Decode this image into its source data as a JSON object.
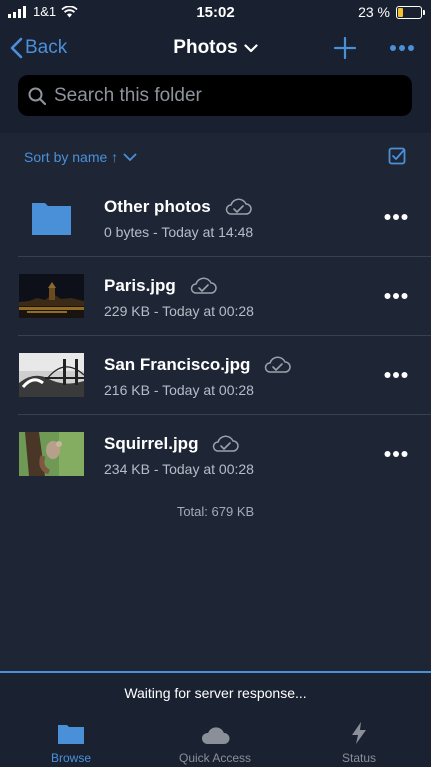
{
  "status_bar": {
    "carrier": "1&1",
    "time": "15:02",
    "battery_percent": "23 %",
    "battery_level": 0.23
  },
  "nav": {
    "back_label": "Back",
    "title": "Photos"
  },
  "search": {
    "placeholder": "Search this folder"
  },
  "sort": {
    "label": "Sort by name ↑"
  },
  "files": [
    {
      "name": "Other photos",
      "meta": "0 bytes - Today at 14:48",
      "type": "folder"
    },
    {
      "name": "Paris.jpg",
      "meta": "229 KB - Today at 00:28",
      "type": "image"
    },
    {
      "name": "San Francisco.jpg",
      "meta": "216 KB - Today at 00:28",
      "type": "image"
    },
    {
      "name": "Squirrel.jpg",
      "meta": "234 KB - Today at 00:28",
      "type": "image"
    }
  ],
  "total": "Total: 679 KB",
  "footer": {
    "status_message": "Waiting for server response..."
  },
  "tabs": [
    {
      "label": "Browse",
      "icon": "folder-icon",
      "active": true
    },
    {
      "label": "Quick Access",
      "icon": "cloud-icon",
      "active": false
    },
    {
      "label": "Status",
      "icon": "lightning-icon",
      "active": false
    }
  ],
  "colors": {
    "background": "#1e2636",
    "header": "#192131",
    "accent": "#4a90d9",
    "battery": "#f2c230"
  }
}
